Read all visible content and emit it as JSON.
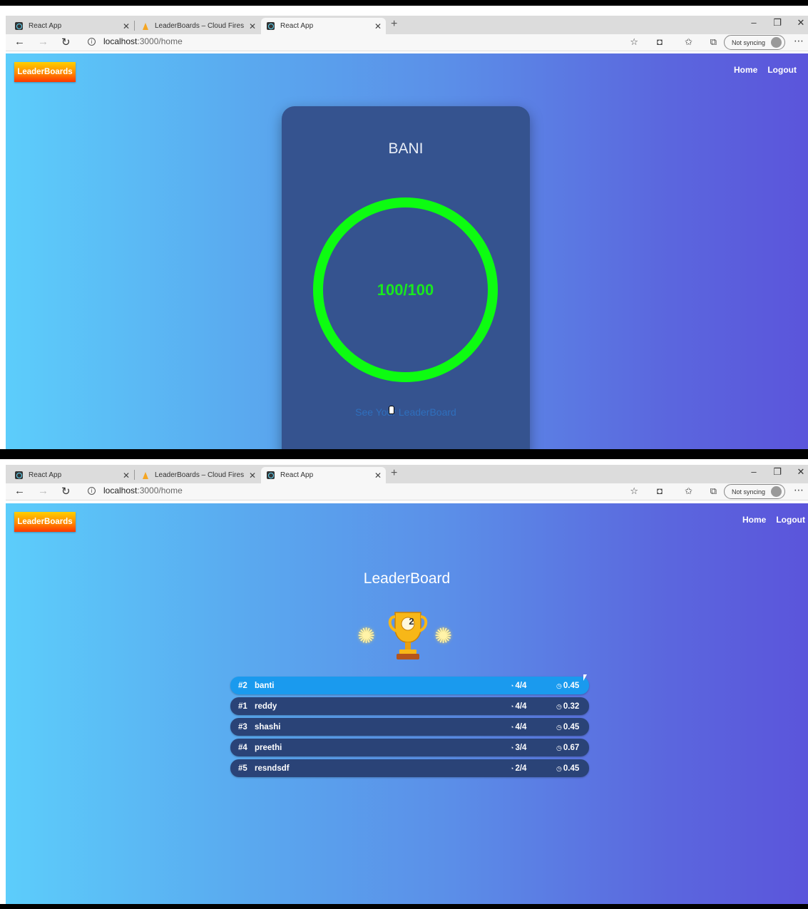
{
  "top": {
    "tabs": [
      {
        "title": "React App",
        "favicon": "react-icon"
      },
      {
        "title": "LeaderBoards – Cloud Firestore ...",
        "favicon": "firebase-icon"
      },
      {
        "title": "React App",
        "favicon": "react-icon"
      }
    ],
    "url_host": "localhost",
    "url_path": ":3000/home",
    "sync_label": "Not syncing",
    "logo": "LeaderBoards",
    "nav": {
      "home": "Home",
      "logout": "Logout"
    },
    "card": {
      "name": "BANI",
      "score": "100/100",
      "link": "See Your LeaderBoard",
      "ring_color": "#0dfc11"
    }
  },
  "bottom": {
    "tabs": [
      {
        "title": "React App",
        "favicon": "react-icon"
      },
      {
        "title": "LeaderBoards – Cloud Firestore ...",
        "favicon": "firebase-icon"
      },
      {
        "title": "React App",
        "favicon": "react-icon"
      }
    ],
    "url_host": "localhost",
    "url_path": ":3000/home",
    "sync_label": "Not syncing",
    "logo": "LeaderBoards",
    "nav": {
      "home": "Home",
      "logout": "Logout"
    },
    "leaderboard": {
      "title": "LeaderBoard",
      "user_rank": "2",
      "rows": [
        {
          "rank": "#2",
          "name": "banti",
          "solved": "4/4",
          "time": "0.45",
          "highlighted": true
        },
        {
          "rank": "#1",
          "name": "reddy",
          "solved": "4/4",
          "time": "0.32",
          "highlighted": false
        },
        {
          "rank": "#3",
          "name": "shashi",
          "solved": "4/4",
          "time": "0.45",
          "highlighted": false
        },
        {
          "rank": "#4",
          "name": "preethi",
          "solved": "3/4",
          "time": "0.67",
          "highlighted": false
        },
        {
          "rank": "#5",
          "name": "resndsdf",
          "solved": "2/4",
          "time": "0.45",
          "highlighted": false
        }
      ],
      "highlight_color": "#1a9aee",
      "row_color": "#2a4377"
    }
  },
  "colors": {
    "gradient_start": "#5ccdfb",
    "gradient_end": "#5b55db",
    "card_bg": "#35538f",
    "logo_gradient": [
      "#ffd000",
      "#ff3800"
    ]
  }
}
